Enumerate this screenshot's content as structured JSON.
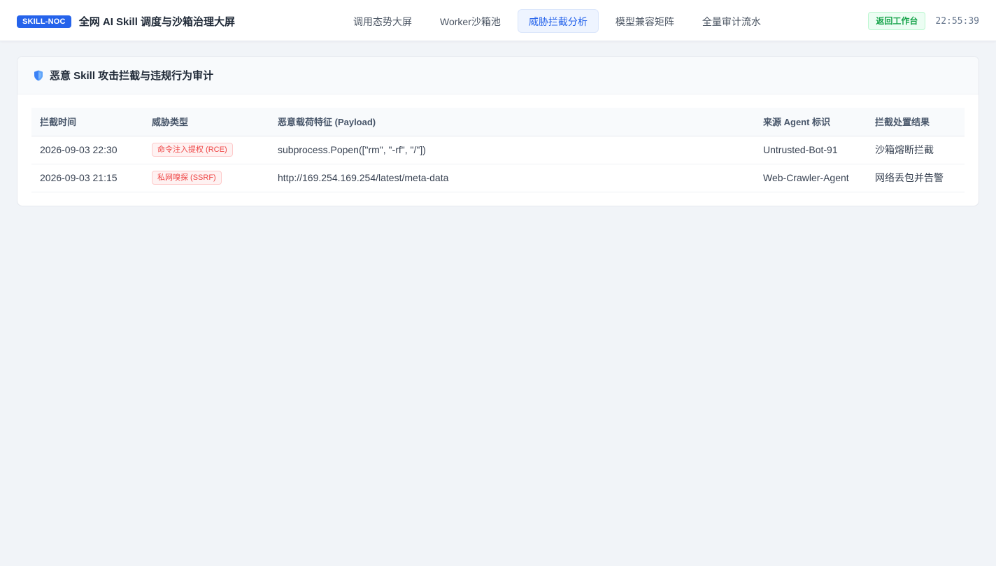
{
  "header": {
    "brand_badge": "SKILL-NOC",
    "title": "全网 AI Skill 调度与沙箱治理大屏",
    "nav": [
      {
        "label": "调用态势大屏",
        "active": false
      },
      {
        "label": "Worker沙箱池",
        "active": false
      },
      {
        "label": "威胁拦截分析",
        "active": true
      },
      {
        "label": "模型兼容矩阵",
        "active": false
      },
      {
        "label": "全量审计流水",
        "active": false
      }
    ],
    "back_button": "返回工作台",
    "clock": "22:55:39"
  },
  "panel": {
    "icon": "shield-icon",
    "title": "恶意 Skill 攻击拦截与违规行为审计",
    "columns": [
      "拦截时间",
      "威胁类型",
      "恶意载荷特征 (Payload)",
      "来源 Agent 标识",
      "拦截处置结果"
    ],
    "rows": [
      {
        "time": "2026-09-03 22:30",
        "threat": "命令注入提权 (RCE)",
        "payload": "subprocess.Popen([\"rm\", \"-rf\", \"/\"])",
        "agent": "Untrusted-Bot-91",
        "result": "沙箱熔断拦截"
      },
      {
        "time": "2026-09-03 21:15",
        "threat": "私网嗅探 (SSRF)",
        "payload": "http://169.254.169.254/latest/meta-data",
        "agent": "Web-Crawler-Agent",
        "result": "网络丢包并告警"
      }
    ]
  },
  "colors": {
    "accent": "#2563eb",
    "threat": "#ef4444",
    "success": "#16a34a",
    "background": "#f1f4f8"
  }
}
